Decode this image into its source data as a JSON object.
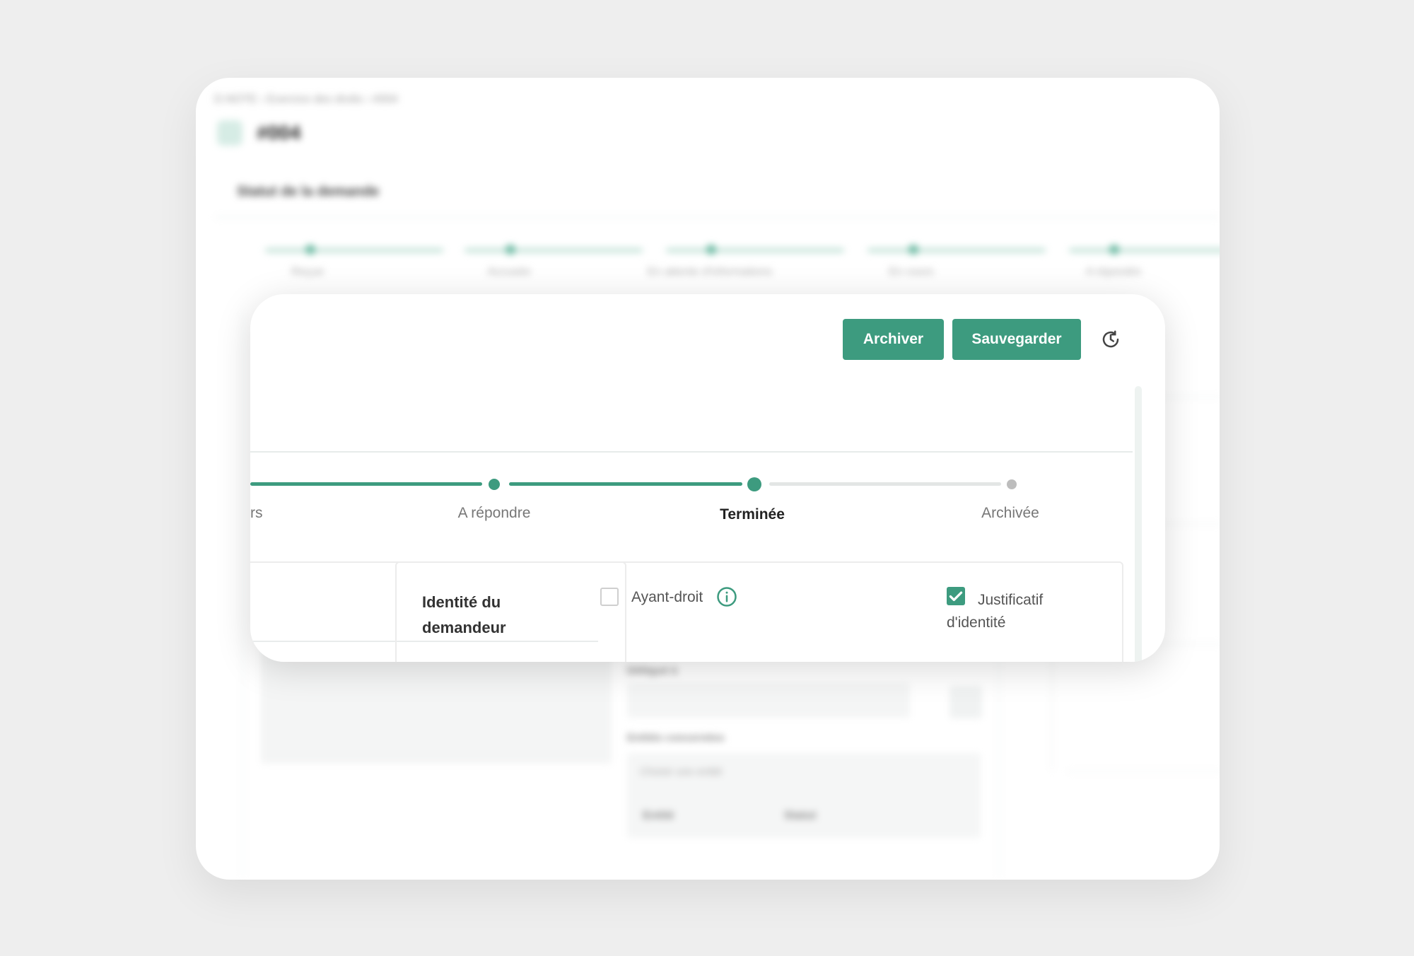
{
  "background": {
    "breadcrumb": "D.NOTE  ›  Exercice des droits  ›  #004",
    "title": "#004",
    "section_title": "Statut de la demande",
    "steps": [
      "Reçue",
      "Accusée",
      "En attente d'informations",
      "En cours",
      "A répondre"
    ],
    "field_label_1": "Délégué à",
    "field_label_2": "Entités concernées",
    "select_placeholder": "Choisir une entité",
    "table_headers": [
      "Entité",
      "Statut"
    ]
  },
  "modal": {
    "actions": {
      "archive_label": "Archiver",
      "save_label": "Sauvegarder",
      "history_icon": "history-icon"
    },
    "stepper": {
      "steps": [
        {
          "label": "rs",
          "state": "done"
        },
        {
          "label": "A répondre",
          "state": "done"
        },
        {
          "label": "Terminée",
          "state": "current"
        },
        {
          "label": "Archivée",
          "state": "todo"
        }
      ]
    },
    "identity": {
      "title": "Identité du demandeur",
      "ayant_droit": {
        "label": "Ayant-droit",
        "checked": false,
        "icon": "info-icon"
      },
      "justificatif": {
        "label": "Justificatif d'identité",
        "checked": true
      }
    }
  },
  "colors": {
    "accent": "#3d9b7f",
    "background": "#eeeeee",
    "inactive_step": "#bdbdbd"
  }
}
